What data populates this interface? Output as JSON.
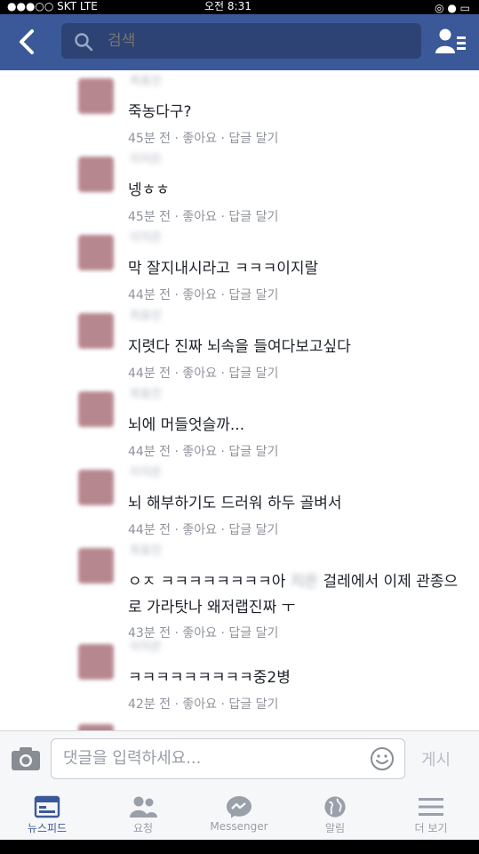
{
  "status_bar": {
    "carrier": "●●●○○ SKT  LTE",
    "time": "오전 8:31",
    "battery": "◎ ● ▭"
  },
  "nav": {
    "search_placeholder": "검색"
  },
  "comments": [
    {
      "name": "최효진",
      "text": "죽농다구?",
      "time": "45분 전",
      "like": "좋아요",
      "reply": "답글 달기"
    },
    {
      "name": "이지은",
      "text": "넹ㅎㅎ",
      "time": "45분 전",
      "like": "좋아요",
      "reply": "답글 달기"
    },
    {
      "name": "이지은",
      "text": "막 잘지내시라고 ㅋㅋㅋ이지랄",
      "time": "44분 전",
      "like": "좋아요",
      "reply": "답글 달기"
    },
    {
      "name": "최효진",
      "text": "지렷다 진짜 뇌속을 들여다보고싶다",
      "time": "44분 전",
      "like": "좋아요",
      "reply": "답글 달기"
    },
    {
      "name": "최효진",
      "text": "뇌에 머들엇슬까...",
      "time": "44분 전",
      "like": "좋아요",
      "reply": "답글 달기"
    },
    {
      "name": "이지은",
      "text": "뇌 해부하기도 드러워 하두 골벼서",
      "time": "44분 전",
      "like": "좋아요",
      "reply": "답글 달기"
    },
    {
      "name": "최효진",
      "text_before": "ㅇㅈ ㅋㅋㅋㅋㅋㅋㅋㅋ아",
      "text_blur": "지은",
      "text_after": "걸레에서 이제 관종으로 가라탓나  왜저랩진짜 ㅜ",
      "time": "43분 전",
      "like": "좋아요",
      "reply": "답글 달기"
    },
    {
      "name": "이지은",
      "text": "ㅋㅋㅋㅋㅋㅋㅋㅋㅋ중2병",
      "time": "42분 전",
      "like": "좋아요",
      "reply": "답글 달기"
    }
  ],
  "comment_bar": {
    "placeholder": "댓글을 입력하세요...",
    "post_label": "게시"
  },
  "tabs": [
    {
      "label": "뉴스피드"
    },
    {
      "label": "요청"
    },
    {
      "label": "Messenger"
    },
    {
      "label": "알림"
    },
    {
      "label": "더 보기"
    }
  ],
  "colors": {
    "brand": "#3b5998",
    "text": "#1d2129",
    "meta": "#8f939b"
  }
}
